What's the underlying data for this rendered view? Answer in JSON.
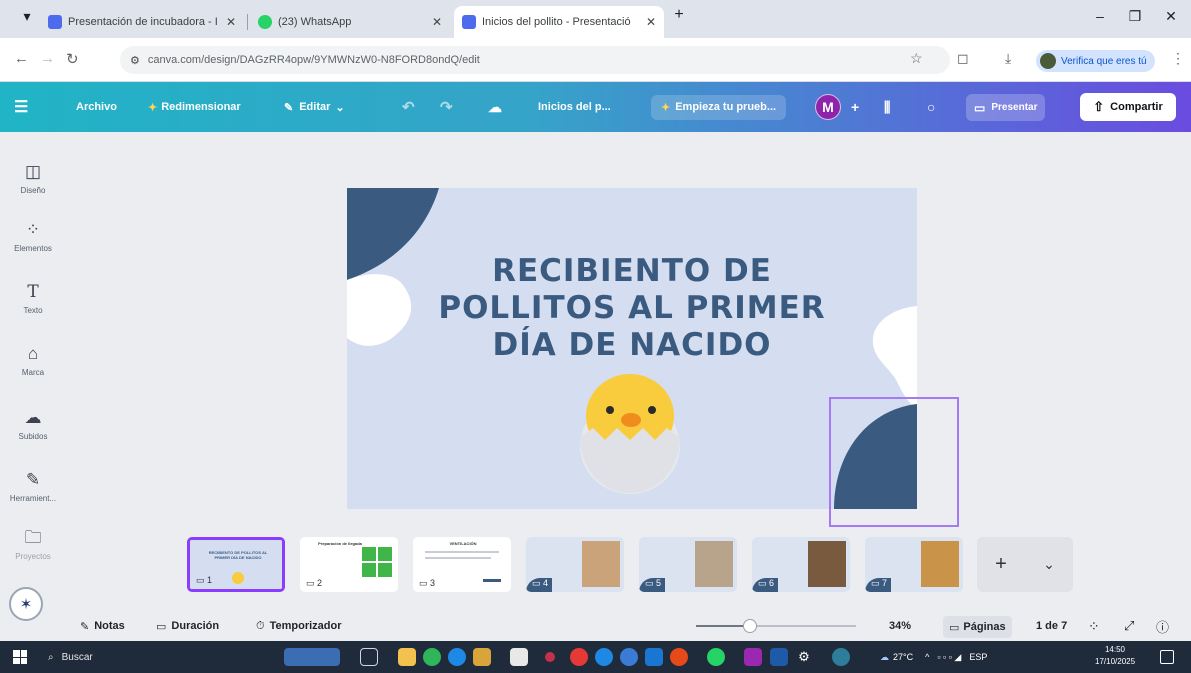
{
  "browser": {
    "tabs": [
      {
        "title": "Presentación de incubadora - I",
        "favicon_color": "#4f6bed",
        "active": false
      },
      {
        "title": "(23) WhatsApp",
        "favicon_color": "#25d366",
        "active": false
      },
      {
        "title": "Inicios del pollito - Presentació",
        "favicon_color": "#4f6bed",
        "active": true
      }
    ],
    "new_tab": "+",
    "address": "canva.com/design/DAGzRR4opw/9YMWNzW0-N8FORD8ondQ/edit",
    "verify_label": "Verifica que eres tú"
  },
  "canva": {
    "menu": {
      "archivo": "Archivo",
      "redimensionar": "Redimensionar",
      "editar": "Editar",
      "doc_title": "Inicios del p...",
      "trial": "Empieza tu prueb...",
      "avatar_letter": "M",
      "presentar": "Presentar",
      "compartir": "Compartir"
    },
    "rail": [
      {
        "label": "Diseño",
        "icon": "layout-icon"
      },
      {
        "label": "Elementos",
        "icon": "elements-icon"
      },
      {
        "label": "Texto",
        "icon": "text-icon"
      },
      {
        "label": "Marca",
        "icon": "brand-icon"
      },
      {
        "label": "Subidos",
        "icon": "uploads-icon"
      },
      {
        "label": "Herramient...",
        "icon": "tools-icon"
      },
      {
        "label": "Proyectos",
        "icon": "projects-icon"
      }
    ],
    "slide": {
      "title_line1": "RECIBIENTO DE",
      "title_line2": "POLLITOS AL PRIMER",
      "title_line3": "DÍA DE NACIDO",
      "colors": {
        "background": "#d4def0",
        "accent": "#3a5a80",
        "chick": "#f8cc3c"
      }
    },
    "thumbnails": [
      {
        "num": "1",
        "title": "RECIBIENTO DE POLLITOS AL PRIMER DÍA DE NACIDO"
      },
      {
        "num": "2",
        "title": "Preparación de llegada"
      },
      {
        "num": "3",
        "title": "VENTILACIÓN"
      },
      {
        "num": "4",
        "title": ""
      },
      {
        "num": "5",
        "title": ""
      },
      {
        "num": "6",
        "title": ""
      },
      {
        "num": "7",
        "title": ""
      }
    ],
    "footer": {
      "notas": "Notas",
      "duracion": "Duración",
      "temporizador": "Temporizador",
      "zoom": "34%",
      "zoom_fraction": 0.34,
      "paginas": "Páginas",
      "page_count": "1 de 7"
    }
  },
  "taskbar": {
    "search": "Buscar",
    "weather": "27°C",
    "lang": "ESP",
    "time": "14:50",
    "date": "17/10/2025"
  }
}
